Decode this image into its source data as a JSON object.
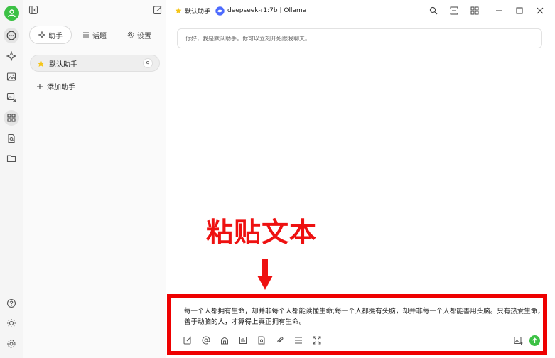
{
  "topbar": {
    "assistant_name": "默认助手",
    "model_name": "deepseek-r1:7b | Ollama"
  },
  "tabs": [
    {
      "label": "助手"
    },
    {
      "label": "话题"
    },
    {
      "label": "设置"
    }
  ],
  "assistants": [
    {
      "name": "默认助手",
      "count": "9"
    }
  ],
  "add_assistant_label": "添加助手",
  "greeting": "你好，我是默认助手。你可以立刻开始跟我聊天。",
  "annotation": "粘贴文本",
  "input_text": "每一个人都拥有生命，却并非每个人都能读懂生命;每一个人都拥有头脑，却并非每一个人都能善用头脑。只有热爱生命，善于动脑的人，才算得上真正拥有生命。",
  "colors": {
    "accent_green": "#3cc145",
    "annotation_red": "#ee0000"
  },
  "icons": {
    "rail": [
      "chat-icon",
      "sparkle-icon",
      "image-icon",
      "translate-image-icon",
      "apps-icon",
      "document-search-icon",
      "folder-icon",
      "help-icon",
      "theme-icon",
      "settings-icon"
    ],
    "toolbar": [
      "pencil-icon",
      "at-icon",
      "web-icon",
      "knowledge-icon",
      "document-icon",
      "paperclip-icon",
      "divider-icon",
      "expand-icon"
    ]
  }
}
